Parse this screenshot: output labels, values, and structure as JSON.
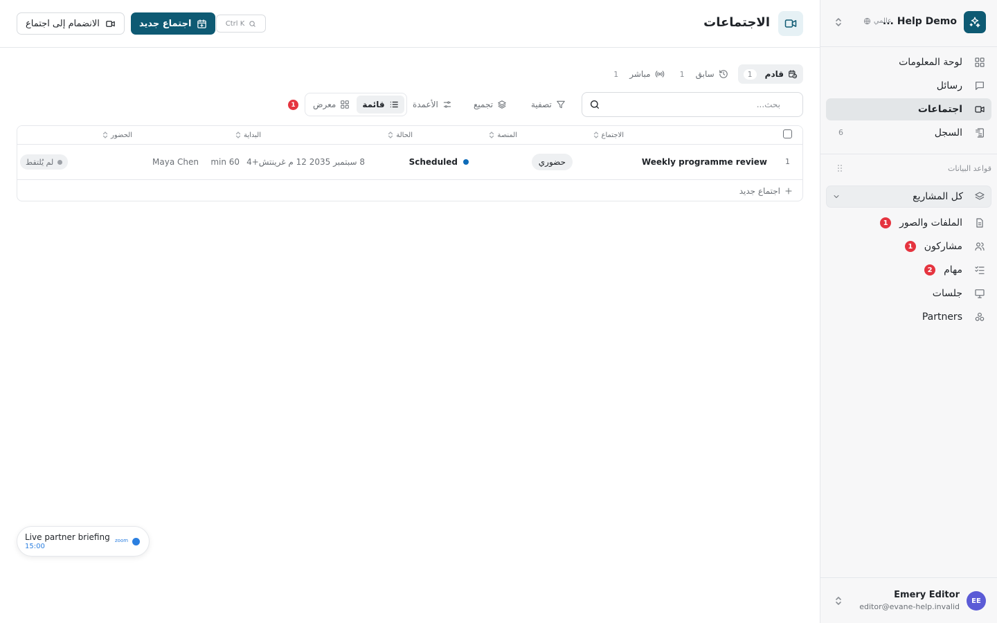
{
  "workspace": {
    "name": "Help Demo ...",
    "scope": "عالمي"
  },
  "sidebar": {
    "items": [
      {
        "label": "لوحة المعلومات",
        "icon": "dashboard-icon"
      },
      {
        "label": "رسائل",
        "icon": "message-icon"
      },
      {
        "label": "اجتماعات",
        "icon": "video-icon",
        "active": true
      },
      {
        "label": "السجل",
        "icon": "log-icon",
        "count": "6"
      }
    ],
    "databases_label": "قواعد البيانات",
    "project_select": "كل المشاريع",
    "db_items": [
      {
        "label": "الملفات والصور",
        "icon": "file-icon",
        "badge": "1"
      },
      {
        "label": "مشاركون",
        "icon": "users-icon",
        "badge": "1"
      },
      {
        "label": "مهام",
        "icon": "tasks-icon",
        "badge": "2"
      },
      {
        "label": "جلسات",
        "icon": "presentation-icon"
      },
      {
        "label": "Partners",
        "icon": "partners-icon"
      }
    ]
  },
  "user": {
    "initials": "EE",
    "name": "Emery Editor",
    "email": "editor@evane-help.invalid"
  },
  "header": {
    "title": "الاجتماعات",
    "new_meeting": "اجتماع جديد",
    "join_meeting": "الانضمام إلى اجتماع",
    "shortcut": "Ctrl K"
  },
  "tabs": [
    {
      "label": "قادم",
      "count": "1",
      "active": true
    },
    {
      "label": "سابق",
      "count": "1"
    },
    {
      "label": "مباشر",
      "count": "1"
    }
  ],
  "search": {
    "placeholder": "بحث..."
  },
  "toolbar": {
    "filter": "تصفية",
    "group": "تجميع",
    "columns": "الأعمدة",
    "list": "قائمة",
    "gallery": "معرض",
    "filter_badge": "1"
  },
  "table": {
    "columns": [
      "الاجتماع",
      "المنصة",
      "الحالة",
      "البداية",
      "الحضور"
    ],
    "rows": [
      {
        "num": "1",
        "meeting": "Weekly programme review",
        "platform": "حضوري",
        "status": "Scheduled",
        "start": "8 سبتمبر 2035 12 م غرينتش+4",
        "duration": "60 min",
        "attendee": "Maya Chen",
        "attendance": "لم يُلتقط"
      }
    ],
    "add_row": "اجتماع جديد"
  },
  "live_card": {
    "title": "Live partner briefing",
    "time": "15:00",
    "platform": "zoom"
  },
  "colors": {
    "accent": "#0e5a73",
    "badge": "#e5343f",
    "status_scheduled": "#0e6bb8",
    "live": "#2b7fe0"
  }
}
